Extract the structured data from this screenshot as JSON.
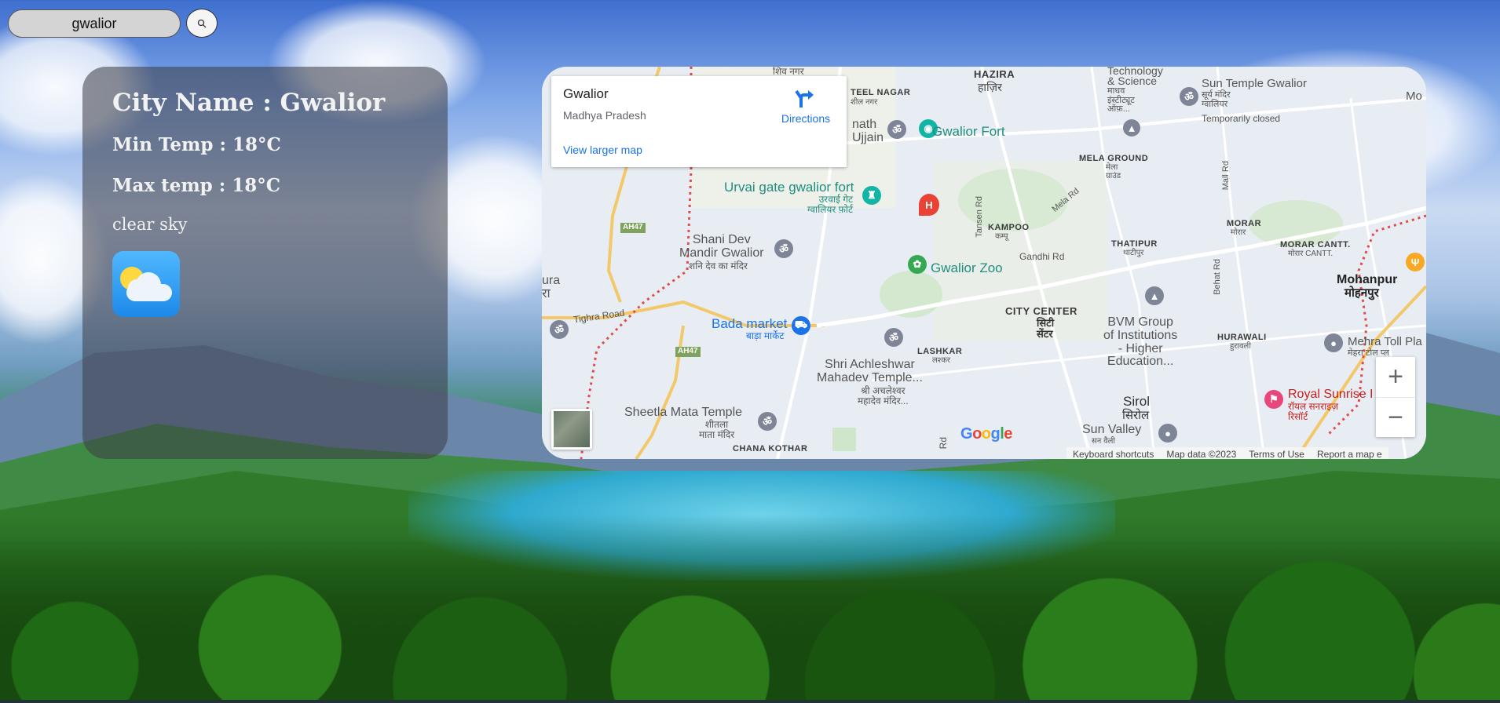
{
  "search": {
    "value": "gwalior",
    "button_icon": "search-icon"
  },
  "weather": {
    "city_line": "City Name : Gwalior",
    "min_temp_line": "Min Temp : 18°C",
    "max_temp_line": "Max temp : 18°C",
    "description": "clear sky",
    "icon": "partly-cloudy-icon"
  },
  "map": {
    "place_title": "Gwalior",
    "place_subtitle": "Madhya Pradesh",
    "directions_label": "Directions",
    "larger_map_link": "View larger map",
    "zoom_in": "+",
    "zoom_out": "−",
    "google_logo": "Google",
    "footer": {
      "shortcuts": "Keyboard shortcuts",
      "map_data": "Map data ©2023",
      "terms": "Terms of Use",
      "report": "Report a map e"
    },
    "labels": {
      "hazira": "HAZIRA",
      "hazira_hi": "हाज़िर",
      "shiv_nagar": "शिव नगर",
      "steel_nagar": "TEEL NAGAR",
      "steel_nagar_hi": "शील नगर",
      "tech_science": "Technology",
      "tech_science2": "& Science",
      "tech_hi": "माधव\nइंस्टीट्यूट\nऑफ़...",
      "sun_temple": "Sun Temple Gwalior",
      "sun_temple_hi": "सूर्य मंदिर\nग्वालियर",
      "temp_closed": "Temporarily closed",
      "moh": "Mo",
      "nath_ujjain": "nath\nUjjain",
      "gwalior_fort": "Gwalior Fort",
      "mela_ground": "MELA GROUND",
      "mela_ground_hi": "मेला\nग्राउंड",
      "mall_rd": "Mall Rd",
      "urvai_gate": "Urvai gate gwalior fort",
      "urvai_gate_hi": "उरवाई गेट\nग्वालियर फ़ोर्ट",
      "tansen_rd": "Tansen Rd",
      "mela_rd": "Mela Rd",
      "kampoo": "KAMPOO",
      "kampoo_hi": "कम्पू",
      "ah47_1": "AH47",
      "ah47_2": "AH47",
      "shani_dev": "Shani Dev\nMandir Gwalior",
      "shani_dev_hi": "शनि देव का मंदिर",
      "thatipur": "THATIPUR",
      "thatipur_hi": "थाटीपुर",
      "morar": "MORAR",
      "morar_hi": "मोरार",
      "morar_cantt": "MORAR CANTT.",
      "morar_cantt_hi": "मोरार CANTT.",
      "mohanpur": "Mohanpur",
      "mohanpur_hi": "मोहनपुर",
      "gandhi_rd": "Gandhi Rd",
      "behat_rd": "Behat Rd",
      "gwalior_zoo": "Gwalior Zoo",
      "ura": "ura\nरा",
      "tighra_road": "Tighra Road",
      "city_center": "CITY CENTER",
      "city_center_hi": "सिटी\nसेंटर",
      "bvm": "BVM Group\nof Institutions\n- Higher\nEducation...",
      "hurawali": "HURAWALI",
      "hurawali_hi": "हुरावली",
      "mehra_toll": "Mehra Toll Pla",
      "mehra_toll_hi": "मेहरा टोल प्ल",
      "bada_market": "Bada market",
      "bada_market_hi": "बाड़ा मार्केट",
      "lashkar": "LASHKAR",
      "lashkar_hi": "लश्कर",
      "achleshwar": "Shri Achleshwar\nMahadev Temple...",
      "achleshwar_hi": "श्री अचलेश्वर\nमहादेव मंदिर...",
      "royal_sunrise": "Royal Sunrise I",
      "royal_sunrise_hi": "रॉयल सनराइज़\nरिसॉर्ट",
      "sirol": "Sirol",
      "sirol_hi": "सिरोल",
      "sheetla": "Sheetla Mata Temple",
      "sheetla_hi": "शीतला\nमाता मंदिर",
      "chana_kothar": "CHANA KOTHAR",
      "sun_valley": "Sun Valley",
      "sun_valley_hi": "सन वैली",
      "rd": "Rd"
    }
  }
}
